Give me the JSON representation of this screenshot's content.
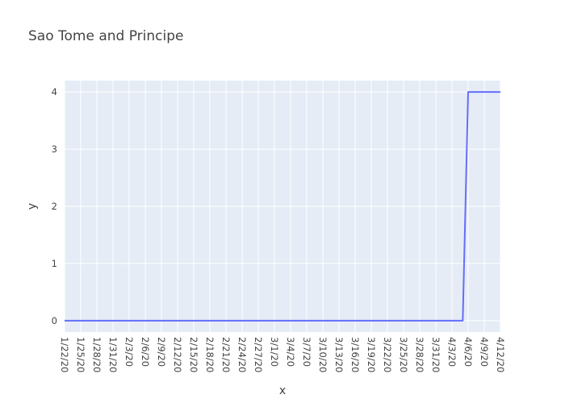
{
  "chart_data": {
    "type": "line",
    "title": "Sao Tome and Principe",
    "xlabel": "x",
    "ylabel": "y",
    "x_tick_labels": [
      "1/22/20",
      "1/25/20",
      "1/28/20",
      "1/31/20",
      "2/3/20",
      "2/6/20",
      "2/9/20",
      "2/12/20",
      "2/15/20",
      "2/18/20",
      "2/21/20",
      "2/24/20",
      "2/27/20",
      "3/1/20",
      "3/4/20",
      "3/7/20",
      "3/10/20",
      "3/13/20",
      "3/16/20",
      "3/19/20",
      "3/22/20",
      "3/25/20",
      "3/28/20",
      "3/31/20",
      "4/3/20",
      "4/6/20",
      "4/9/20",
      "4/12/20"
    ],
    "y_ticks": [
      0,
      1,
      2,
      3,
      4
    ],
    "ylim": [
      -0.2,
      4.2
    ],
    "grid": true,
    "series": [
      {
        "color": "#636efa",
        "x": [
          "1/22/20",
          "1/23/20",
          "1/24/20",
          "1/25/20",
          "1/26/20",
          "1/27/20",
          "1/28/20",
          "1/29/20",
          "1/30/20",
          "1/31/20",
          "2/1/20",
          "2/2/20",
          "2/3/20",
          "2/4/20",
          "2/5/20",
          "2/6/20",
          "2/7/20",
          "2/8/20",
          "2/9/20",
          "2/10/20",
          "2/11/20",
          "2/12/20",
          "2/13/20",
          "2/14/20",
          "2/15/20",
          "2/16/20",
          "2/17/20",
          "2/18/20",
          "2/19/20",
          "2/20/20",
          "2/21/20",
          "2/22/20",
          "2/23/20",
          "2/24/20",
          "2/25/20",
          "2/26/20",
          "2/27/20",
          "2/28/20",
          "2/29/20",
          "3/1/20",
          "3/2/20",
          "3/3/20",
          "3/4/20",
          "3/5/20",
          "3/6/20",
          "3/7/20",
          "3/8/20",
          "3/9/20",
          "3/10/20",
          "3/11/20",
          "3/12/20",
          "3/13/20",
          "3/14/20",
          "3/15/20",
          "3/16/20",
          "3/17/20",
          "3/18/20",
          "3/19/20",
          "3/20/20",
          "3/21/20",
          "3/22/20",
          "3/23/20",
          "3/24/20",
          "3/25/20",
          "3/26/20",
          "3/27/20",
          "3/28/20",
          "3/29/20",
          "3/30/20",
          "3/31/20",
          "4/1/20",
          "4/2/20",
          "4/3/20",
          "4/4/20",
          "4/5/20",
          "4/6/20",
          "4/7/20",
          "4/8/20",
          "4/9/20",
          "4/10/20",
          "4/11/20",
          "4/12/20"
        ],
        "values": [
          0,
          0,
          0,
          0,
          0,
          0,
          0,
          0,
          0,
          0,
          0,
          0,
          0,
          0,
          0,
          0,
          0,
          0,
          0,
          0,
          0,
          0,
          0,
          0,
          0,
          0,
          0,
          0,
          0,
          0,
          0,
          0,
          0,
          0,
          0,
          0,
          0,
          0,
          0,
          0,
          0,
          0,
          0,
          0,
          0,
          0,
          0,
          0,
          0,
          0,
          0,
          0,
          0,
          0,
          0,
          0,
          0,
          0,
          0,
          0,
          0,
          0,
          0,
          0,
          0,
          0,
          0,
          0,
          0,
          0,
          0,
          0,
          0,
          0,
          0,
          4,
          4,
          4,
          4,
          4,
          4,
          4
        ]
      }
    ]
  }
}
